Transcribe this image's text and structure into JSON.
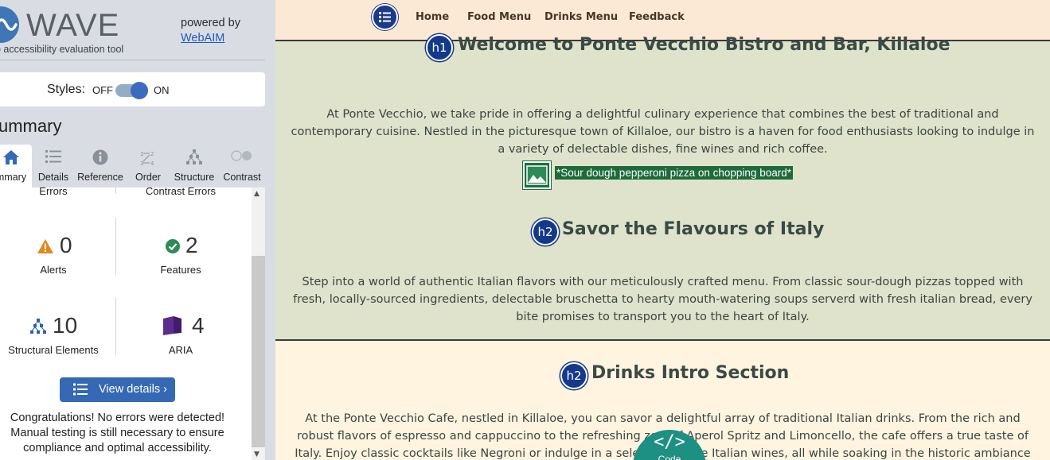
{
  "wave": {
    "logo_text": "WAVE",
    "logo_sub": "o accessibility evaluation tool",
    "powered_by": "powered by",
    "webaim_link": "WebAIM",
    "styles_label": "Styles:",
    "styles_off": "OFF",
    "styles_on": "ON",
    "styles_state": "on",
    "summary_title": "ummary",
    "tabs": [
      {
        "label": "mmary",
        "icon": "home-icon",
        "active": true
      },
      {
        "label": "Details",
        "icon": "list-icon",
        "active": false
      },
      {
        "label": "Reference",
        "icon": "info-icon",
        "active": false
      },
      {
        "label": "Order",
        "icon": "order-icon",
        "active": false
      },
      {
        "label": "Structure",
        "icon": "structure-icon",
        "active": false
      },
      {
        "label": "Contrast",
        "icon": "contrast-icon",
        "active": false
      }
    ],
    "summary": {
      "errors_label": "Errors",
      "contrast_label": "Contrast Errors",
      "alerts": {
        "count": "0",
        "label": "Alerts",
        "icon": "alert-icon"
      },
      "features": {
        "count": "2",
        "label": "Features",
        "icon": "feature-check-icon"
      },
      "structural": {
        "count": "10",
        "label": "Structural Elements",
        "icon": "structure-icon"
      },
      "aria": {
        "count": "4",
        "label": "ARIA",
        "icon": "aria-icon"
      }
    },
    "view_details": "View details ›",
    "congrats": "Congratulations! No errors were detected! Manual testing is still necessary to ensure compliance and optimal accessibility.",
    "colors": {
      "accent": "#3569b3",
      "sidebar_bg": "#d9dde3",
      "alert": "#e08a1e",
      "feature": "#2e8b57",
      "aria": "#5b2d8e"
    }
  },
  "site": {
    "nav": {
      "menu_icon": "list-icon",
      "links": [
        "Home",
        "Food Menu",
        "Drinks Menu",
        "Feedback"
      ]
    },
    "h1_badge": "h1",
    "h1": "Welcome to Ponte Vecchio Bistro and Bar, Killaloe",
    "intro": "At Ponte Vecchio, we take pride in offering a delightful culinary experience that combines the best of traditional and contemporary cuisine. Nestled in the picturesque town of Killaloe, our bistro is a haven for food enthusiasts looking to indulge in a variety of delectable dishes, fine wines and rich coffee.",
    "image_alt": "*Sour dough pepperoni pizza on chopping board*",
    "h2_badge": "h2",
    "h2_food": "Savor the Flavours of Italy",
    "food_para": "Step into a world of authentic Italian flavors with our meticulously crafted menu. From classic sour-dough pizzas topped with fresh, locally-sourced ingredients, delectable bruschetta to hearty mouth-watering soups serverd with fresh italian bread, every bite promises to transport you to the heart of Italy.",
    "h2_drinks": "Drinks Intro Section",
    "drinks_para": "At the Ponte Vecchio Cafe, nestled in Killaloe, you can savor a delightful array of traditional Italian drinks. From the rich and robust flavors of espresso and cappuccino to the refreshing zest of Aperol Spritz and Limoncello, the cafe offers a true taste of Italy. Enjoy classic cocktails like Negroni or indulge in a selection of fine Italian wines, all while soaking in the historic ambiance of this",
    "code_button": {
      "symbol": "</>",
      "label": "Code"
    },
    "colors": {
      "nav_bg": "#fbe9d6",
      "section1_bg": "#dfe3cc",
      "section2_bg": "#fef4e0",
      "text": "#3a4a45",
      "badge": "#14398a",
      "alt_bg": "#1e6b3a",
      "code_bg": "#1e8f83"
    }
  }
}
